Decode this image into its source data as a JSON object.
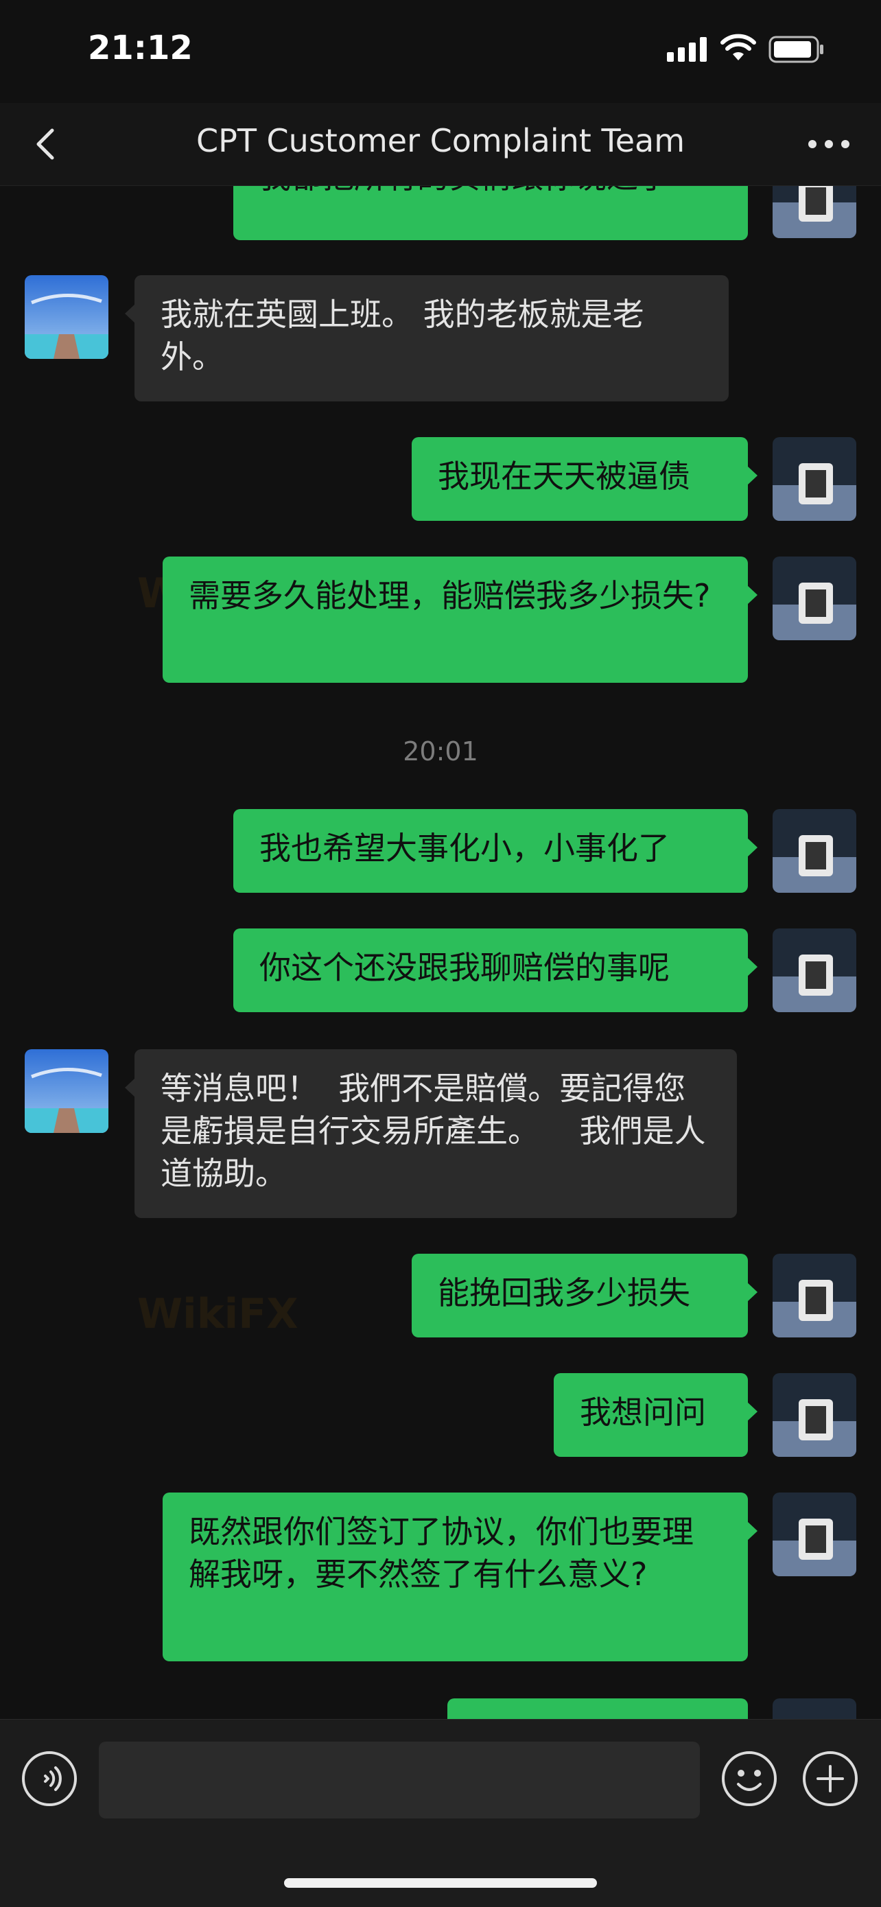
{
  "status_bar": {
    "time": "21:12"
  },
  "header": {
    "title": "CPT Customer Complaint Team"
  },
  "messages": [
    {
      "side": "out",
      "text": "我都把所有的实情跟你说过了"
    },
    {
      "side": "in",
      "text": "我就在英國上班。 我的老板就是老外。"
    },
    {
      "side": "out",
      "text": "我现在天天被逼债"
    },
    {
      "side": "out",
      "text": "需要多久能处理，能赔偿我多少损失?"
    },
    {
      "side": "time",
      "text": "20:01"
    },
    {
      "side": "out",
      "text": "我也希望大事化小，小事化了"
    },
    {
      "side": "out",
      "text": "你这个还没跟我聊赔偿的事呢"
    },
    {
      "side": "in",
      "text": "等消息吧！  我們不是賠償。要記得您是虧損是自行交易所產生。    我們是人道協助。"
    },
    {
      "side": "out",
      "text": "能挽回我多少损失"
    },
    {
      "side": "out",
      "text": "我想问问"
    },
    {
      "side": "out",
      "text": "既然跟你们签订了协议，你们也要理解我呀，要不然签了有什么意义?"
    },
    {
      "side": "out",
      "text": ""
    }
  ],
  "watermark": "WikiFX",
  "input": {
    "value": "",
    "placeholder": ""
  },
  "icons": {
    "back": "chevron-left-icon",
    "more": "more-dots-icon",
    "voice": "voice-icon",
    "emoji": "emoji-icon",
    "plus": "plus-icon"
  },
  "colors": {
    "background": "#111111",
    "outgoing_bubble": "#2cbe5a",
    "incoming_bubble": "#2b2b2b",
    "timestamp": "#7c7c7c"
  }
}
